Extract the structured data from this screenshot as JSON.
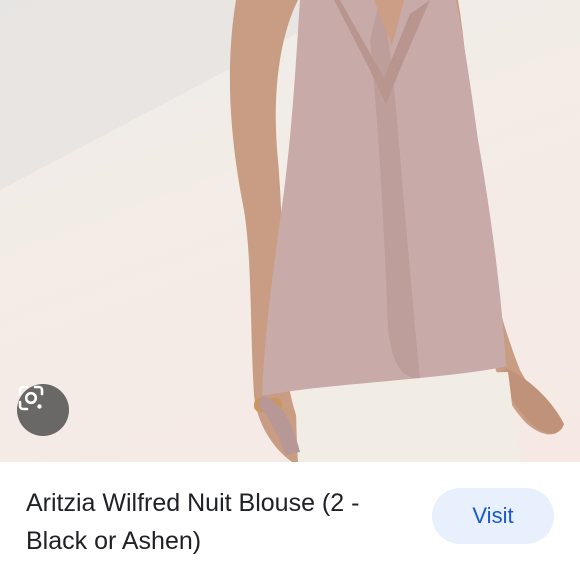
{
  "result": {
    "image_alt": "Aritzia Wilfred Nuit Blouse (2 - Black or Ashen)",
    "lens_icon": "google-lens-icon",
    "title": "Aritzia Wilfred Nuit Blouse (2 - Black or Ashen)",
    "visit_label": "Visit"
  },
  "colors": {
    "accent": "#1a57c8",
    "button_bg": "#e8f0fe",
    "blouse": "#c8aaa8",
    "text": "#202124"
  }
}
